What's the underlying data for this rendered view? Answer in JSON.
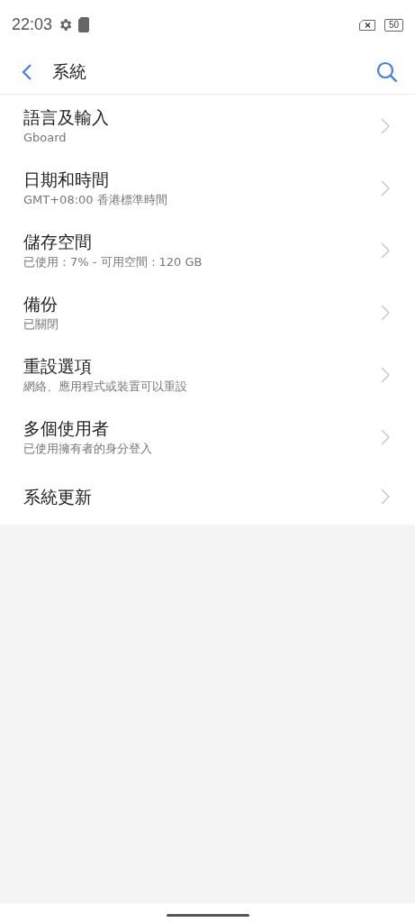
{
  "status_bar": {
    "time": "22:03",
    "battery": "50"
  },
  "toolbar": {
    "title": "系統"
  },
  "items": [
    {
      "title": "語言及輸入",
      "subtitle": "Gboard"
    },
    {
      "title": "日期和時間",
      "subtitle": "GMT+08:00 香港標準時間"
    },
    {
      "title": "儲存空間",
      "subtitle": "已使用：7% - 可用空間：120 GB"
    },
    {
      "title": "備份",
      "subtitle": "已關閉"
    },
    {
      "title": "重設選項",
      "subtitle": "網絡、應用程式或裝置可以重設"
    },
    {
      "title": "多個使用者",
      "subtitle": "已使用擁有者的身分登入"
    },
    {
      "title": "系統更新"
    }
  ]
}
